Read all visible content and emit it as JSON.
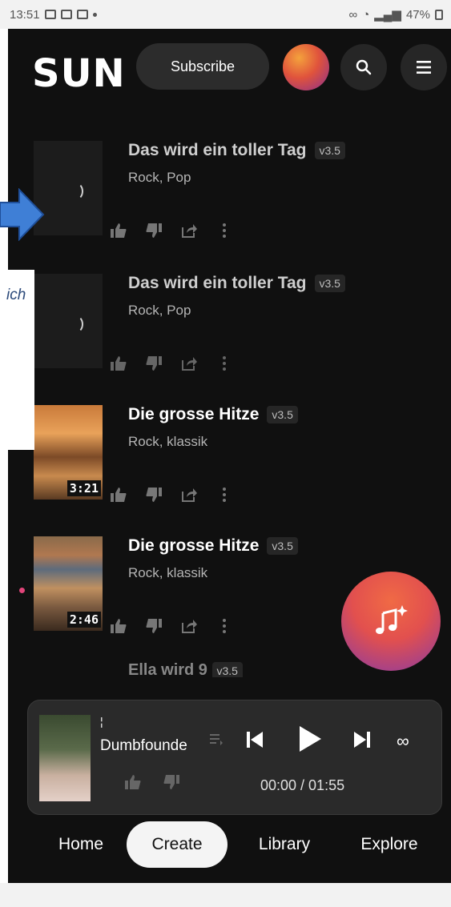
{
  "status_bar": {
    "time": "13:51",
    "battery": "47%"
  },
  "header": {
    "logo": "SUN",
    "subscribe_label": "Subscribe"
  },
  "songs": [
    {
      "title": "Das wird ein toller Tag",
      "version": "v3.5",
      "genre": "Rock, Pop",
      "duration": "",
      "state": "loading"
    },
    {
      "title": "Das wird ein toller Tag",
      "version": "v3.5",
      "genre": "Rock, Pop",
      "duration": "",
      "state": "loading"
    },
    {
      "title": "Die grosse Hitze",
      "version": "v3.5",
      "genre": "Rock, klassik",
      "duration": "3:21",
      "state": "ready"
    },
    {
      "title": "Die grosse Hitze",
      "version": "v3.5",
      "genre": "Rock, klassik",
      "duration": "2:46",
      "state": "ready"
    }
  ],
  "partial_song": {
    "title": "Ella wird 9",
    "version": "v3.5"
  },
  "overlay": {
    "text": "ich"
  },
  "player": {
    "mark": "¦",
    "title": "Dumbfounde",
    "time": "00:00 / 01:55"
  },
  "nav": {
    "items": [
      "Home",
      "Create",
      "Library",
      "Explore"
    ],
    "active": "Create"
  },
  "colors": {
    "background": "#101010",
    "accent_gradient_start": "#f06a45",
    "accent_gradient_end": "#8a3aa3",
    "arrow_blue": "#3f7fd6"
  }
}
